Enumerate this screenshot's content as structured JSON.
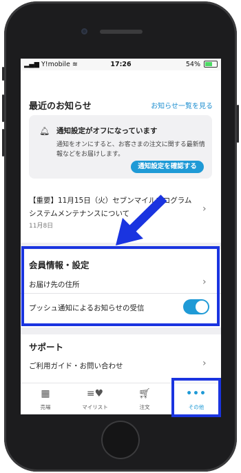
{
  "status_bar": {
    "carrier": "Y!mobile",
    "time": "17:26",
    "battery": "54%"
  },
  "notices": {
    "title": "最近のお知らせ",
    "view_all_link": "お知らせ一覧を見る",
    "alert": {
      "title": "通知設定がオフになっています",
      "body": "通知をオンにすると、お客さまの注文に関する最新情報などをお届けします。",
      "button": "通知設定を確認する"
    },
    "news_item": {
      "text": "【重要】11月15日（火）セブンマイルプログラム システムメンテナンスについて",
      "date": "11月8日"
    }
  },
  "member": {
    "title": "会員情報・設定",
    "address_label": "お届け先の住所",
    "push_label": "プッシュ通知によるお知らせの受信",
    "push_enabled": true
  },
  "support": {
    "title": "サポート",
    "guide_label": "ご利用ガイド・お問い合わせ"
  },
  "tabbar": {
    "items": [
      {
        "label": "売場",
        "icon": "store-icon"
      },
      {
        "label": "マイリスト",
        "icon": "mylist-icon"
      },
      {
        "label": "注文",
        "icon": "cart-icon"
      },
      {
        "label": "その他",
        "icon": "more-icon"
      }
    ],
    "active_index": 3
  },
  "colors": {
    "accent": "#1f9ad6",
    "highlight": "#1a34e0"
  }
}
